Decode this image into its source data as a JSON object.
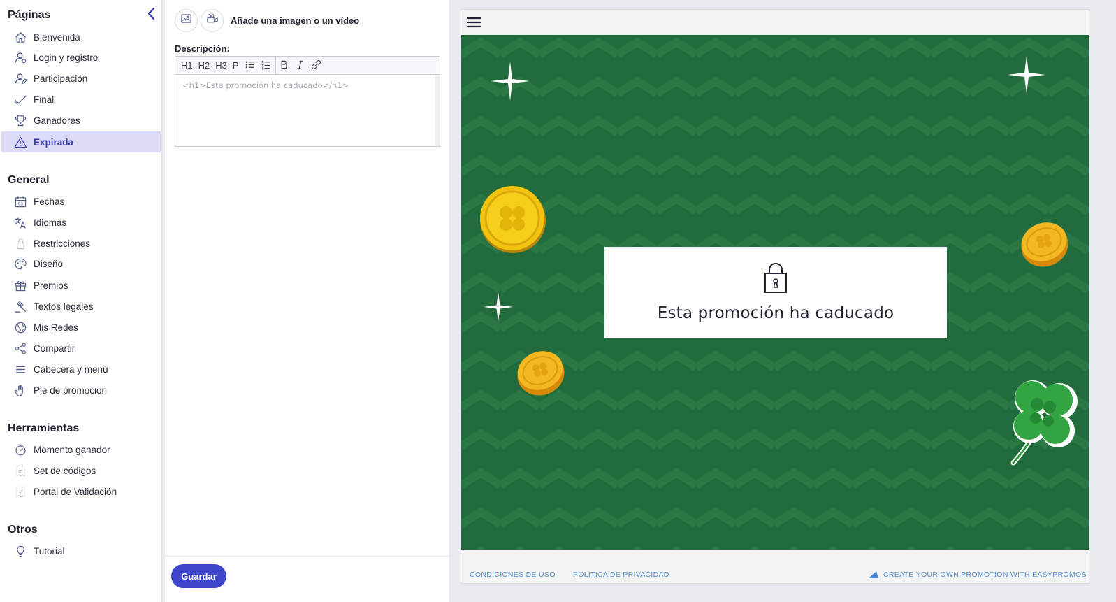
{
  "sidebar": {
    "sections": [
      {
        "title": "Páginas",
        "items": [
          {
            "label": "Bienvenida",
            "icon": "home-icon"
          },
          {
            "label": "Login y registro",
            "icon": "user-settings-icon"
          },
          {
            "label": "Participación",
            "icon": "user-edit-icon"
          },
          {
            "label": "Final",
            "icon": "check-icon"
          },
          {
            "label": "Ganadores",
            "icon": "trophy-icon"
          },
          {
            "label": "Expirada",
            "icon": "warning-icon",
            "active": true
          }
        ]
      },
      {
        "title": "General",
        "items": [
          {
            "label": "Fechas",
            "icon": "calendar-icon"
          },
          {
            "label": "Idiomas",
            "icon": "translate-icon"
          },
          {
            "label": "Restricciones",
            "icon": "lock-icon"
          },
          {
            "label": "Diseño",
            "icon": "palette-icon"
          },
          {
            "label": "Premios",
            "icon": "gift-icon"
          },
          {
            "label": "Textos legales",
            "icon": "gavel-icon"
          },
          {
            "label": "Mis Redes",
            "icon": "globe-icon"
          },
          {
            "label": "Compartir",
            "icon": "share-icon"
          },
          {
            "label": "Cabecera y menú",
            "icon": "menu-icon"
          },
          {
            "label": "Pie de promoción",
            "icon": "hand-icon"
          }
        ]
      },
      {
        "title": "Herramientas",
        "items": [
          {
            "label": "Momento ganador",
            "icon": "stopwatch-icon"
          },
          {
            "label": "Set de códigos",
            "icon": "codes-icon"
          },
          {
            "label": "Portal de Validación",
            "icon": "validation-icon"
          }
        ]
      },
      {
        "title": "Otros",
        "items": [
          {
            "label": "Tutorial",
            "icon": "bulb-icon"
          }
        ]
      }
    ]
  },
  "editor": {
    "media_label": "Añade una imagen o un vídeo",
    "description_label": "Descripción:",
    "toolbar": [
      "H1",
      "H2",
      "H3",
      "P"
    ],
    "content": "<h1>Esta promoción ha caducado</h1>",
    "save_label": "Guardar"
  },
  "preview": {
    "message": "Esta promoción ha caducado",
    "footer": {
      "terms": "CONDICIONES DE USO",
      "privacy": "POLÍTICA DE PRIVACIDAD",
      "brand": "CREATE YOUR OWN PROMOTION WITH EASYPROMOS"
    },
    "colors": {
      "accent": "#3d44c9",
      "stage": "#216b3c",
      "active_bg": "#dcdcf8"
    }
  }
}
